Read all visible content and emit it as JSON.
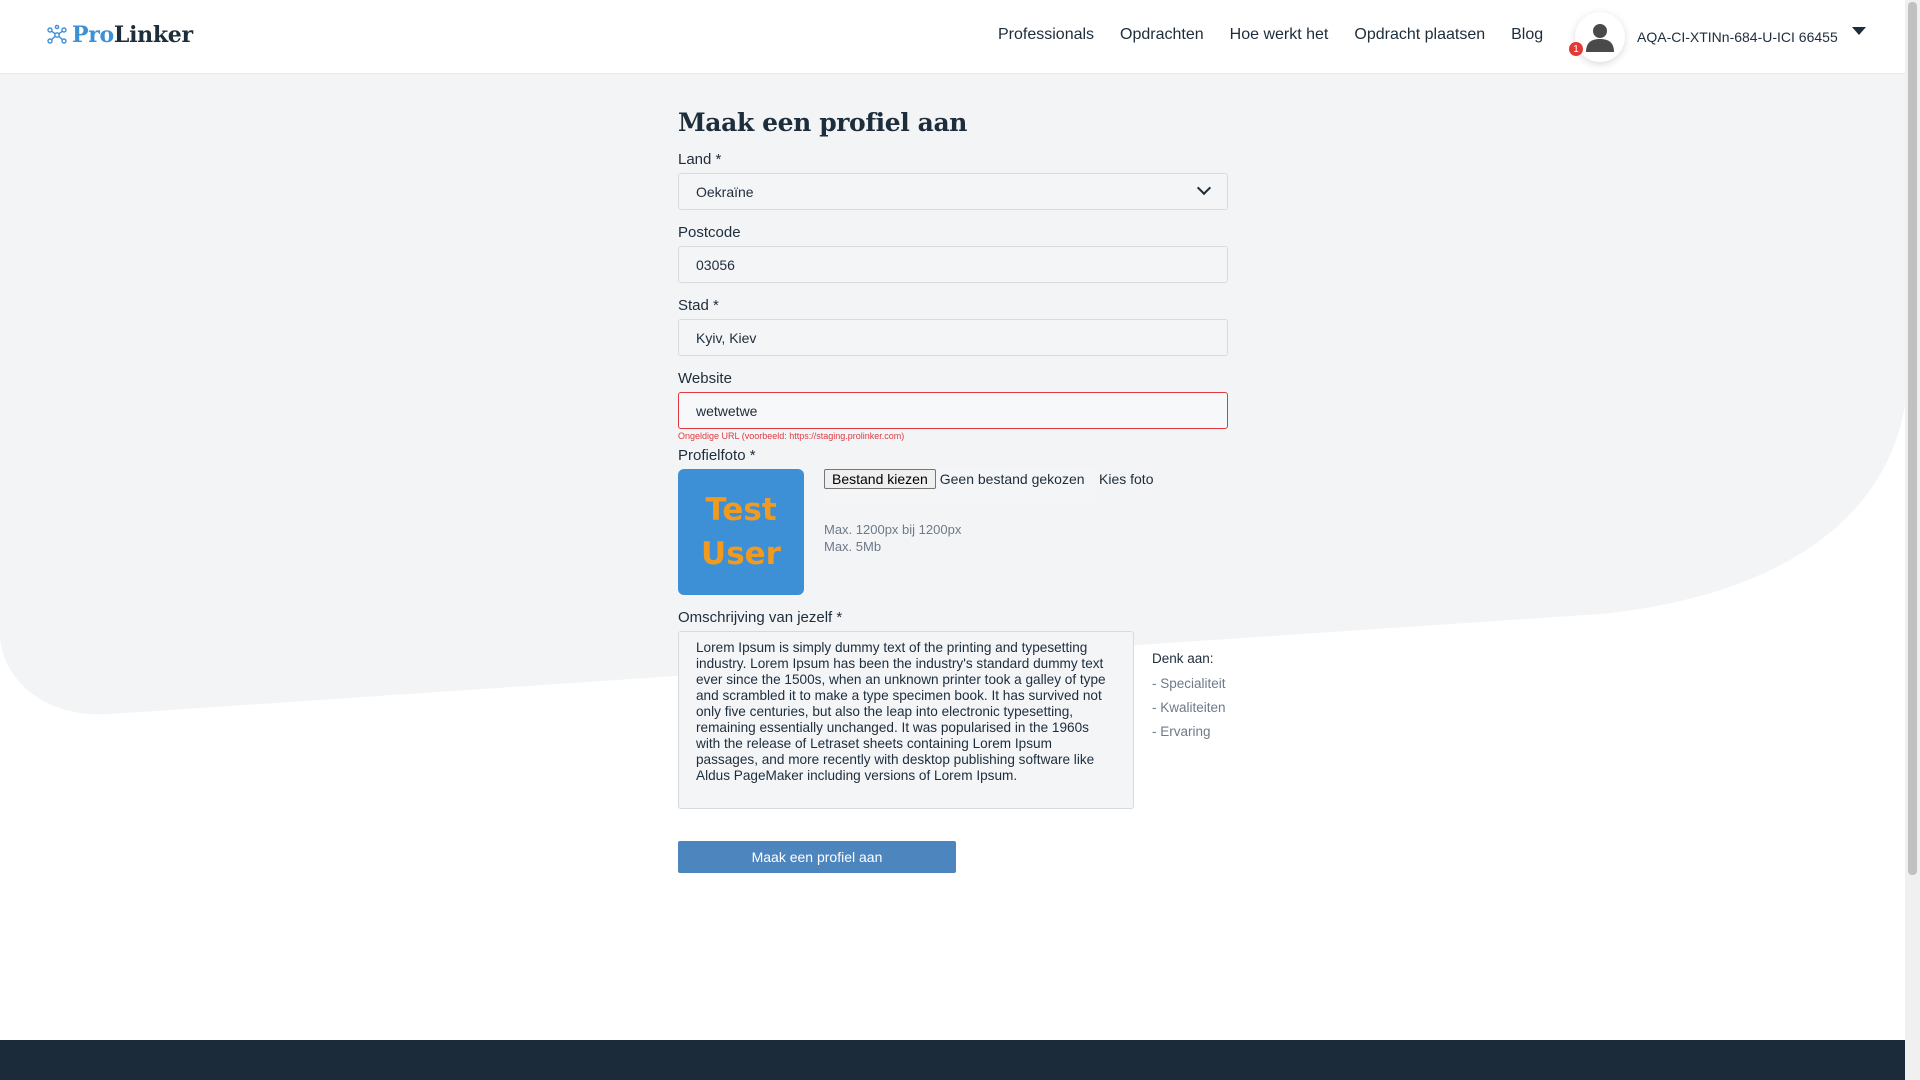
{
  "header": {
    "logo_pro": "Pro",
    "logo_linker": "Linker",
    "nav": [
      "Professionals",
      "Opdrachten",
      "Hoe werkt het",
      "Opdracht plaatsen",
      "Blog"
    ],
    "notification_count": "1",
    "username": "AQA-CI-XTINn-684-U-ICI 66455"
  },
  "form": {
    "title": "Maak een profiel aan",
    "country_label": "Land *",
    "country_value": "Oekraïne",
    "postcode_label": "Postcode",
    "postcode_value": "03056",
    "city_label": "Stad *",
    "city_value": "Kyiv, Kiev",
    "website_label": "Website",
    "website_value": "wetwetwe",
    "website_error": "Ongeldige URL (voorbeeld: https://staging.prolinker.com)",
    "photo_label": "Profielfoto *",
    "photo_text_line1": "Test",
    "photo_text_line2": "User",
    "file_button": "Bestand kiezen",
    "file_none": "Geen bestand gekozen",
    "choose_photo": "Kies foto",
    "hint_size": "Max. 1200px bij 1200px",
    "hint_weight": "Max. 5Mb",
    "description_label": "Omschrijving van jezelf *",
    "description_value": "Lorem Ipsum is simply dummy text of the printing and typesetting industry. Lorem Ipsum has been the industry's standard dummy text ever since the 1500s, when an unknown printer took a galley of type and scrambled it to make a type specimen book. It has survived not only five centuries, but also the leap into electronic typesetting, remaining essentially unchanged. It was popularised in the 1960s with the release of Letraset sheets containing Lorem Ipsum passages, and more recently with desktop publishing software like Aldus PageMaker including versions of Lorem Ipsum.",
    "tips_title": "Denk aan:",
    "tips": [
      "- Specialiteit",
      "- Kwaliteiten",
      "- Ervaring"
    ],
    "submit_label": "Maak een profiel aan"
  },
  "colors": {
    "accent": "#3d8fd6",
    "button": "#4d85be",
    "error": "#e0393e",
    "text": "#1e2d3b",
    "footer": "#1c2b3a",
    "background_shape": "#f3f4f6"
  }
}
